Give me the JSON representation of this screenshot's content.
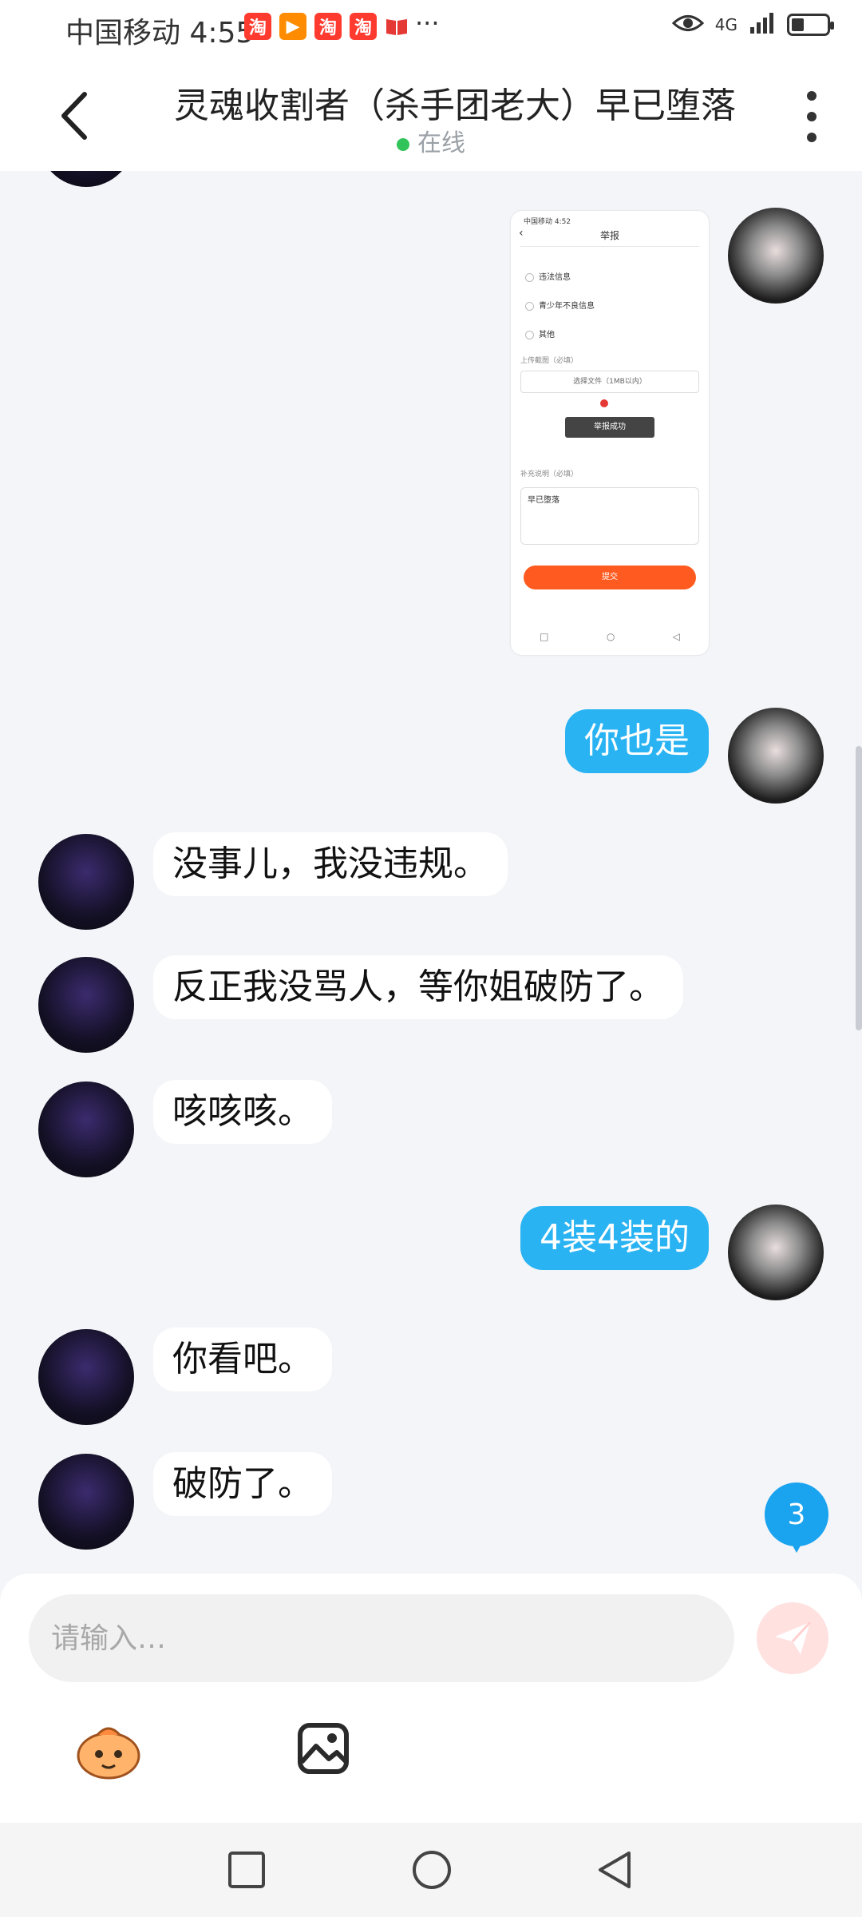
{
  "status_bar": {
    "carrier_time": "中国移动 4:55",
    "apps": [
      {
        "glyph": "淘",
        "color": "#ff3b30"
      },
      {
        "glyph": "▶",
        "color": "#ff8c00"
      },
      {
        "glyph": "淘",
        "color": "#ff3b30"
      },
      {
        "glyph": "淘",
        "color": "#ff3b30"
      }
    ],
    "more": "···",
    "network": "4G",
    "battery_level": 0.35
  },
  "header": {
    "title": "灵魂收割者（杀手团老大）早已堕落",
    "status": "在线",
    "status_color": "#32c45a"
  },
  "image_message": {
    "status": "中国移动 4:52",
    "title": "举报",
    "options": [
      "违法信息",
      "青少年不良信息",
      "其他"
    ],
    "upload_label": "上传截图（必填）",
    "file_button": "选择文件（1MB以内）",
    "toast": "举报成功",
    "note_label": "补充说明（必填）",
    "note_text": "早已堕落",
    "submit": "提交",
    "nav": [
      "□",
      "○",
      "◁"
    ]
  },
  "messages": [
    {
      "side": "right",
      "text": "你也是"
    },
    {
      "side": "left",
      "text": "没事儿，我没违规。"
    },
    {
      "side": "left",
      "text": "反正我没骂人，等你姐破防了。"
    },
    {
      "side": "left",
      "text": "咳咳咳。"
    },
    {
      "side": "right",
      "text": "4装4装的"
    },
    {
      "side": "left",
      "text": "你看吧。"
    },
    {
      "side": "left",
      "text": "破防了。"
    }
  ],
  "unread_count": "3",
  "composer": {
    "placeholder": "请输入…",
    "send_icon": "send-icon",
    "tools": [
      "emoji-mascot-icon",
      "image-icon"
    ]
  },
  "navbar": {
    "buttons": [
      "recent-apps-icon",
      "home-icon",
      "back-icon"
    ]
  },
  "colors": {
    "accent": "#29b3f2",
    "background": "#f3f5f8"
  }
}
